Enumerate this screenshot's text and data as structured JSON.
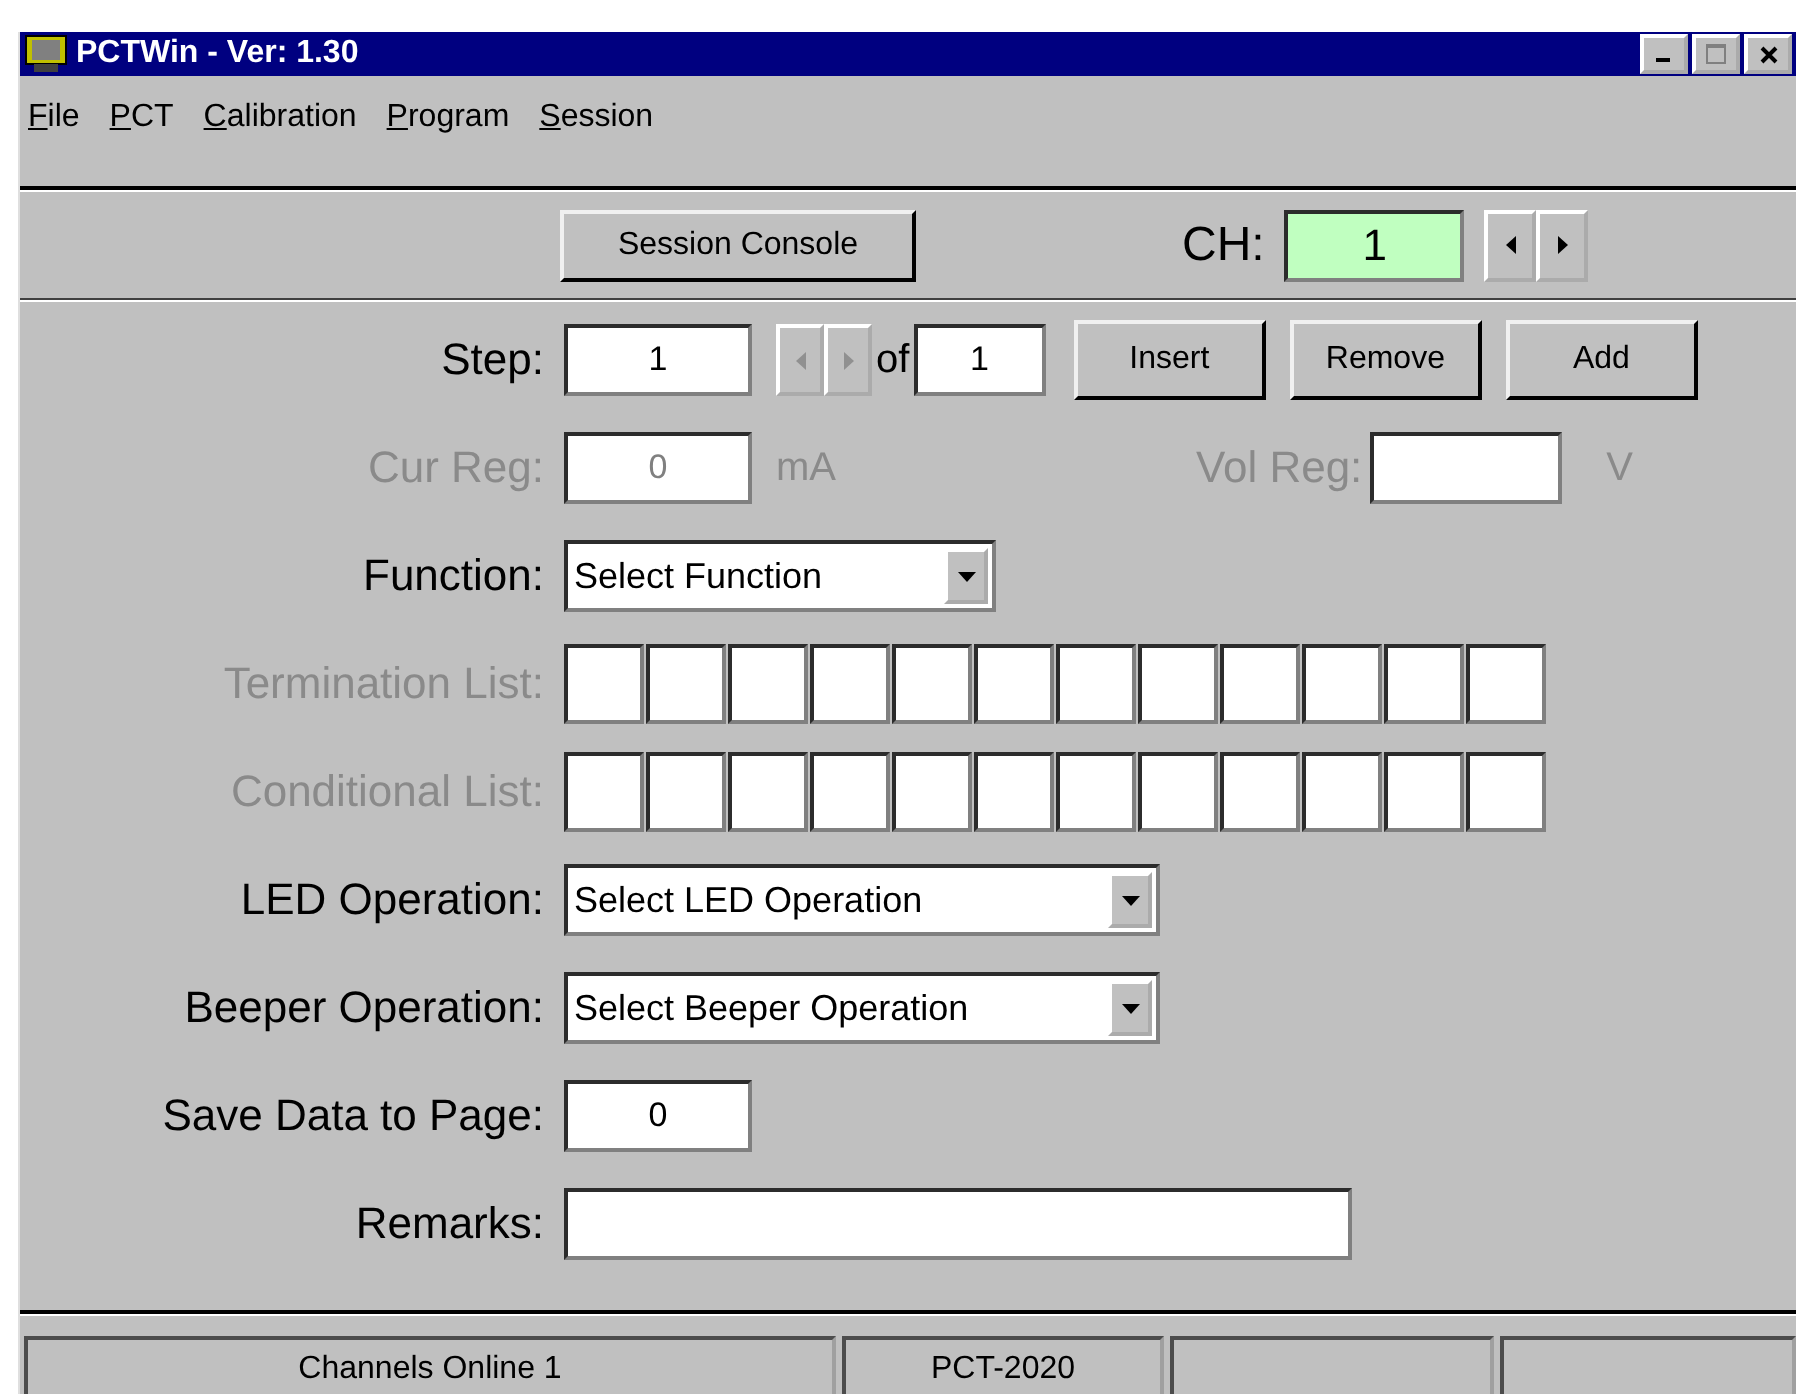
{
  "window": {
    "title": "PCTWin - Ver: 1.30"
  },
  "menu": [
    {
      "label": "File"
    },
    {
      "label": "PCT"
    },
    {
      "label": "Calibration"
    },
    {
      "label": "Program"
    },
    {
      "label": "Session"
    }
  ],
  "toolbar": {
    "session_button": "Session Console",
    "channel_label": "CH:",
    "channel_value": "1"
  },
  "step": {
    "label": "Step:",
    "value": "1",
    "prev_disabled": true,
    "next_disabled": true,
    "of_label": "of",
    "total": "1",
    "buttons": [
      "Insert",
      "Remove",
      "Add"
    ]
  },
  "cur_reg": {
    "label": "Cur Reg:",
    "value": "0",
    "unit": "mA",
    "disabled": true
  },
  "vol_reg": {
    "label": "Vol Reg:",
    "unit": "V",
    "disabled": true
  },
  "function": {
    "label": "Function:",
    "value": "Select Function",
    "disabled": false
  },
  "termination_list": {
    "label": "Termination List:",
    "disabled": true
  },
  "conditional_list": {
    "label": "Conditional List:",
    "disabled": true
  },
  "led_operation": {
    "label": "LED Operation:",
    "value": "Select LED Operation",
    "disabled": false
  },
  "beeper_operation": {
    "label": "Beeper Operation:",
    "value": "Select Beeper Operation",
    "disabled": false
  },
  "save_page": {
    "label": "Save Data to Page:",
    "value": "0"
  },
  "remarks": {
    "label": "Remarks:"
  },
  "status_bar": [
    "Channels Online  1",
    "PCT-2020"
  ]
}
